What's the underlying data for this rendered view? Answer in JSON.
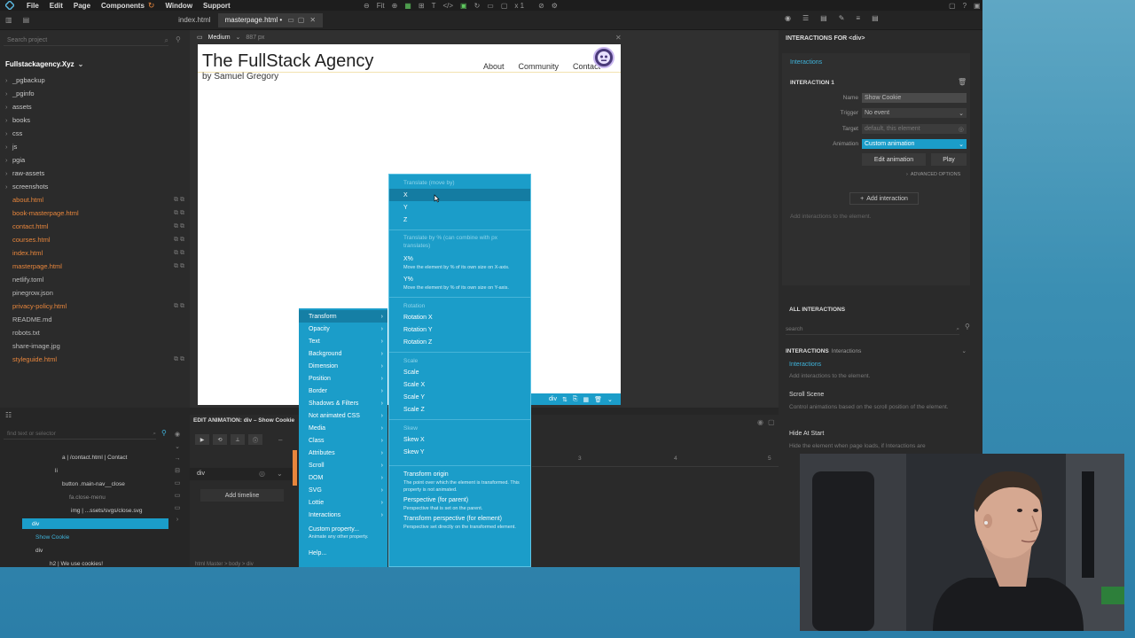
{
  "menubar": {
    "items": [
      "File",
      "Edit",
      "Page",
      "Components",
      "Window",
      "Support"
    ]
  },
  "toolbar": {
    "fit_label": "Fit",
    "zoom_label": "x 1"
  },
  "tabs": [
    {
      "label": "index.html"
    },
    {
      "label": "masterpage.html •"
    }
  ],
  "leftpanel": {
    "search_placeholder": "Search project",
    "project_name": "Fullstackagency.Xyz",
    "items": [
      {
        "label": "_pgbackup",
        "kind": "folder"
      },
      {
        "label": "_pginfo",
        "kind": "folder"
      },
      {
        "label": "assets",
        "kind": "folder"
      },
      {
        "label": "books",
        "kind": "folder"
      },
      {
        "label": "css",
        "kind": "folder"
      },
      {
        "label": "js",
        "kind": "folder"
      },
      {
        "label": "pgia",
        "kind": "folder"
      },
      {
        "label": "raw-assets",
        "kind": "folder"
      },
      {
        "label": "screenshots",
        "kind": "folder"
      },
      {
        "label": "about.html",
        "kind": "file"
      },
      {
        "label": "book-masterpage.html",
        "kind": "file"
      },
      {
        "label": "contact.html",
        "kind": "file"
      },
      {
        "label": "courses.html",
        "kind": "file"
      },
      {
        "label": "index.html",
        "kind": "file"
      },
      {
        "label": "masterpage.html",
        "kind": "file"
      },
      {
        "label": "netlify.toml",
        "kind": "plain"
      },
      {
        "label": "pinegrow.json",
        "kind": "plain"
      },
      {
        "label": "privacy-policy.html",
        "kind": "file"
      },
      {
        "label": "README.md",
        "kind": "plain"
      },
      {
        "label": "robots.txt",
        "kind": "plain"
      },
      {
        "label": "share-image.jpg",
        "kind": "plain"
      },
      {
        "label": "styleguide.html",
        "kind": "file"
      }
    ]
  },
  "canvas": {
    "device_label": "Medium",
    "width_label": "887 px",
    "site_title": "The FullStack Agency",
    "site_subtitle": "by Samuel Gregory",
    "nav": [
      "About",
      "Community",
      "Contact"
    ],
    "selected_tag": "div"
  },
  "rightpanel": {
    "header": "INTERACTIONS FOR <div>",
    "interactions_link": "Interactions",
    "interaction_title": "INTERACTION 1",
    "name_label": "Name",
    "name_value": "Show Cookie",
    "trigger_label": "Trigger",
    "trigger_value": "No event",
    "target_label": "Target",
    "target_value": "default, this element",
    "animation_label": "Animation",
    "animation_value": "Custom animation",
    "edit_animation": "Edit animation",
    "play": "Play",
    "advanced": "ADVANCED OPTIONS",
    "add_interaction": "Add interaction",
    "add_hint": "Add interactions to the element.",
    "all_interactions": "ALL INTERACTIONS",
    "search_placeholder": "search",
    "group_title": "INTERACTIONS",
    "group_sub": "Interactions",
    "list": [
      {
        "title": "Interactions",
        "desc": "Add interactions to the element."
      },
      {
        "title": "Scroll Scene",
        "desc": "Control animations based on the scroll position of the element."
      },
      {
        "title": "Hide At Start",
        "desc": "Hide the element when page loads, if Interactions are"
      }
    ]
  },
  "bottompanel": {
    "search_placeholder": "find text or selector",
    "tree": [
      {
        "text": "a | /contact.html | Contact",
        "indent": 70
      },
      {
        "text": "li",
        "indent": 62
      },
      {
        "text": "button .main-nav__close",
        "indent": 70
      },
      {
        "text": "fa.close-menu",
        "indent": 78
      },
      {
        "text": "img | ...ssets/svgs/close.svg",
        "indent": 80
      },
      {
        "text": "div",
        "indent": 36
      },
      {
        "text": "Show Cookie",
        "indent": 40
      },
      {
        "text": "div",
        "indent": 40
      },
      {
        "text": "h2 | We use cookies!",
        "indent": 56
      }
    ],
    "edit_title": "EDIT ANIMATION: div – Show Cookie",
    "track_label": "div",
    "add_timeline": "Add timeline",
    "ruler": [
      "3",
      "4",
      "5"
    ],
    "breadcrumb": "html Master  >  body  >  div"
  },
  "menu1": {
    "items": [
      "Transform",
      "Opacity",
      "Text",
      "Background",
      "Dimension",
      "Position",
      "Border",
      "Shadows & Filters",
      "Not animated CSS",
      "Media",
      "Class",
      "Attributes",
      "Scroll",
      "DOM",
      "SVG",
      "Lottie",
      "Interactions"
    ],
    "custom_title": "Custom property...",
    "custom_desc": "Animate any other property.",
    "help": "Help..."
  },
  "menu2": {
    "h_translate": "Translate (move by)",
    "x": "X",
    "y": "Y",
    "z": "Z",
    "h_translate_pct": "Translate by % (can combine with px translates)",
    "xpct": "X%",
    "xpct_desc": "Move the element by % of its own size on X-axis.",
    "ypct": "Y%",
    "ypct_desc": "Move the element by % of its own size on Y-axis.",
    "h_rotation": "Rotation",
    "rotx": "Rotation X",
    "roty": "Rotation Y",
    "rotz": "Rotation Z",
    "h_scale": "Scale",
    "scale": "Scale",
    "scalex": "Scale X",
    "scaley": "Scale Y",
    "scalez": "Scale Z",
    "h_skew": "Skew",
    "skewx": "Skew X",
    "skewy": "Skew Y",
    "origin": "Transform origin",
    "origin_desc": "The point over which the element is transformed. This property is not animated.",
    "persp_parent": "Perspective (for parent)",
    "persp_parent_desc": "Perspective that is set on the parent.",
    "persp_elem": "Transform perspective (for element)",
    "persp_elem_desc": "Perspective set directly on the transformed element."
  }
}
